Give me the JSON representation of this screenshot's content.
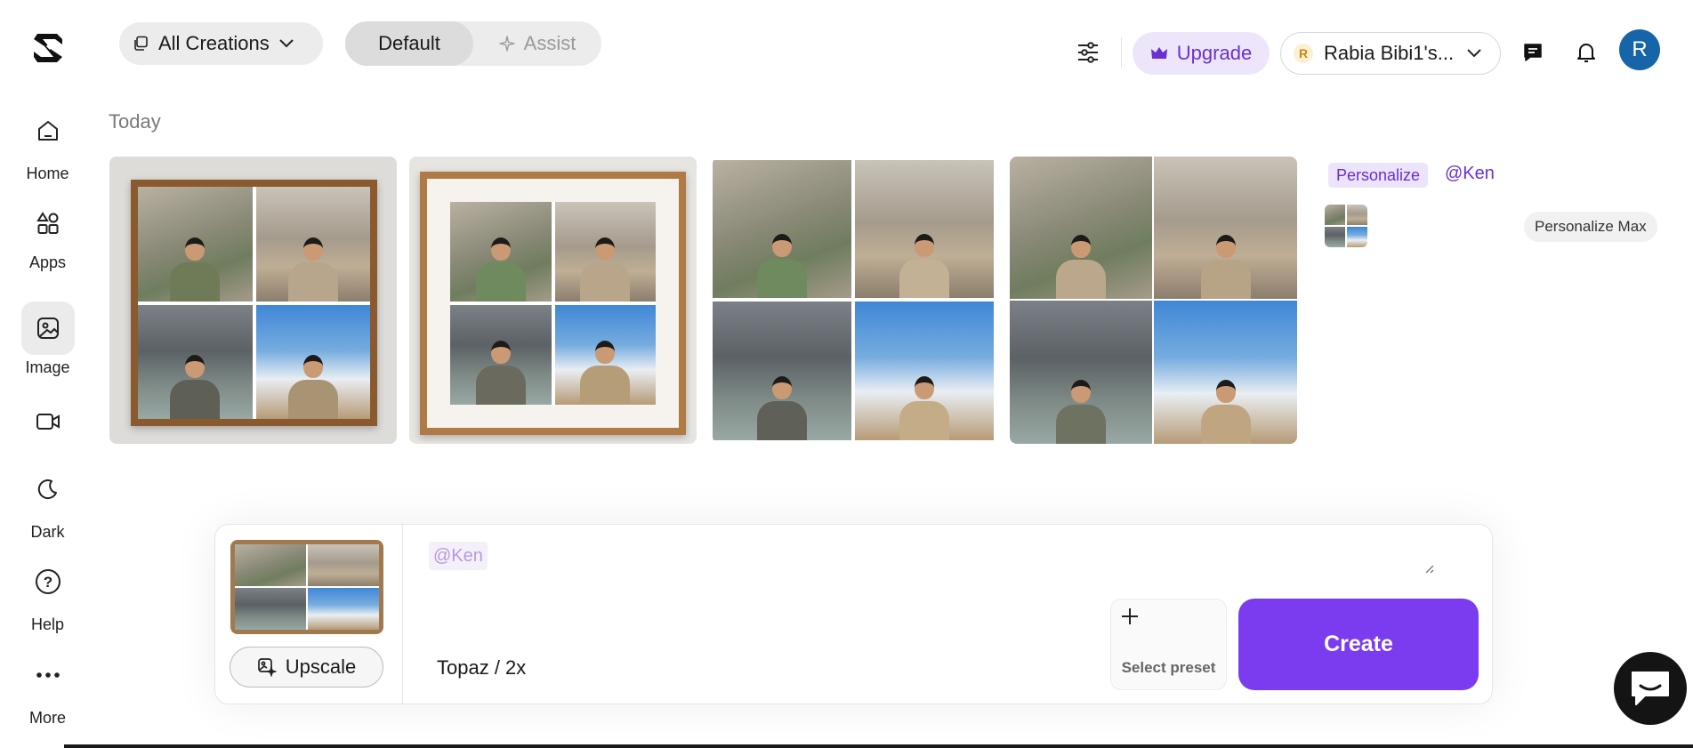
{
  "sidebar": {
    "items": [
      {
        "label": "Home",
        "icon": "home-icon"
      },
      {
        "label": "Apps",
        "icon": "apps-icon"
      },
      {
        "label": "Image",
        "icon": "image-icon",
        "active": true
      },
      {
        "label": "",
        "icon": "video-icon"
      },
      {
        "label": "Dark",
        "icon": "moon-icon"
      },
      {
        "label": "Help",
        "icon": "help-icon"
      },
      {
        "label": "More",
        "icon": "more-icon"
      }
    ]
  },
  "topbar": {
    "creations_label": "All Creations",
    "mode_default": "Default",
    "mode_assist": "Assist",
    "upgrade_label": "Upgrade",
    "account_initial": "R",
    "account_name": "Rabia Bibi1's...",
    "avatar_initial": "R"
  },
  "content": {
    "section_heading": "Today"
  },
  "personalize": {
    "tag": "Personalize",
    "mention": "@Ken",
    "max_label": "Personalize Max"
  },
  "composer": {
    "prompt_chip": "@Ken",
    "upscale_label": "Upscale",
    "model_label": "Topaz / 2x",
    "preset_label": "Select preset",
    "create_label": "Create"
  },
  "colors": {
    "accent": "#7b3cf0",
    "accent_soft": "#ede6fb",
    "avatar": "#1565a8"
  }
}
